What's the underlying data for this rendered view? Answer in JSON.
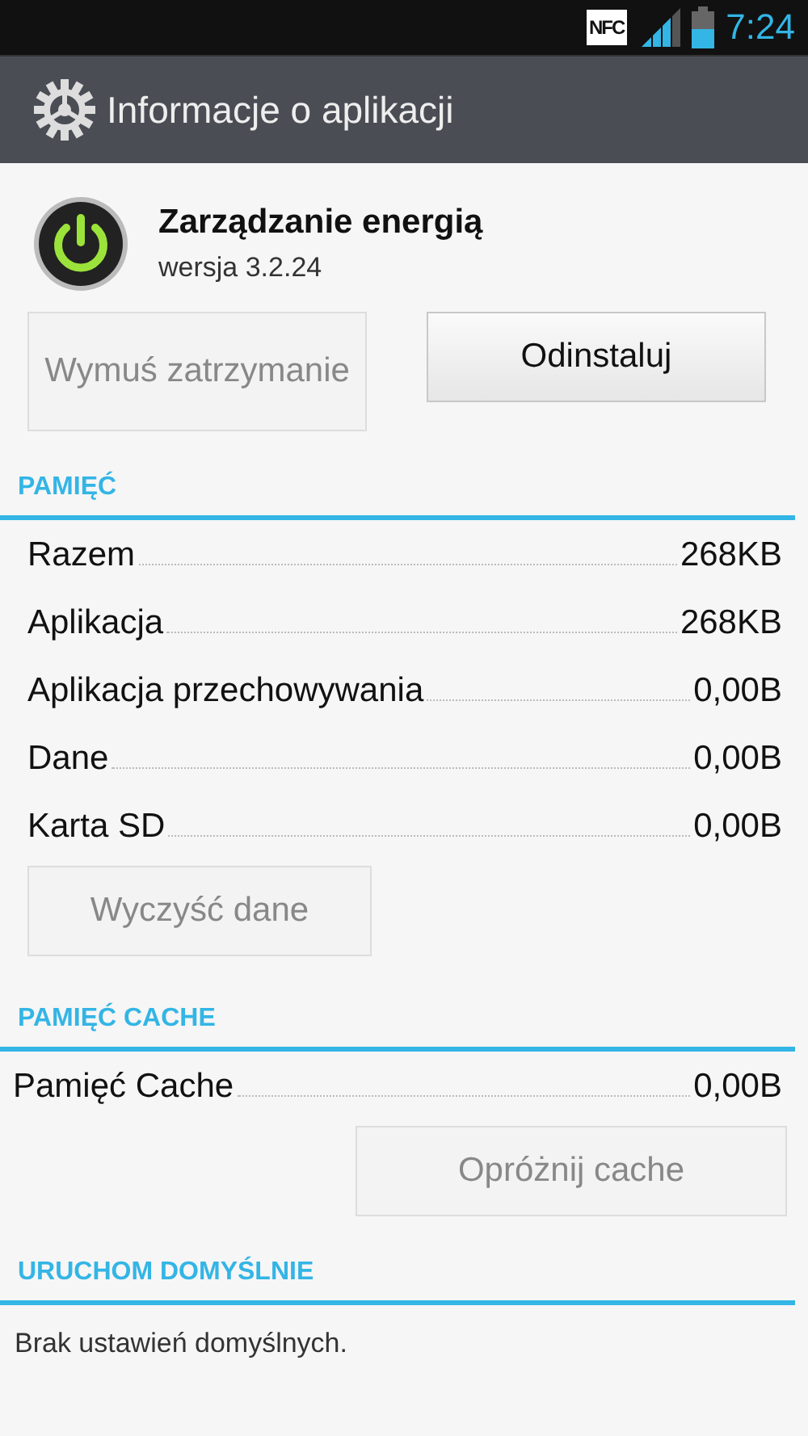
{
  "status_bar": {
    "nfc": "NFC",
    "time": "7:24"
  },
  "action_bar": {
    "title": "Informacje o aplikacji"
  },
  "app": {
    "name": "Zarządzanie energią",
    "version": "wersja 3.2.24"
  },
  "app_buttons": [
    {
      "label": "Wymuś zatrzymanie",
      "disabled": true
    },
    {
      "label": "Odinstaluj",
      "disabled": false
    }
  ],
  "sections": [
    {
      "title": "PAMIĘĆ",
      "rows": [
        {
          "label": "Razem",
          "value": "268KB"
        },
        {
          "label": "Aplikacja",
          "value": "268KB"
        },
        {
          "label": "Aplikacja przechowywania",
          "value": "0,00B"
        },
        {
          "label": "Dane",
          "value": "0,00B"
        },
        {
          "label": "Karta SD",
          "value": "0,00B"
        }
      ],
      "button": {
        "label": "Wyczyść dane",
        "disabled": true
      }
    },
    {
      "title": "PAMIĘĆ CACHE",
      "rows": [
        {
          "label": "Pamięć Cache",
          "value": "0,00B"
        }
      ],
      "button": {
        "label": "Opróżnij cache",
        "disabled": true
      }
    },
    {
      "title": "URUCHOM DOMYŚLNIE",
      "text": "Brak ustawień domyślnych."
    }
  ]
}
